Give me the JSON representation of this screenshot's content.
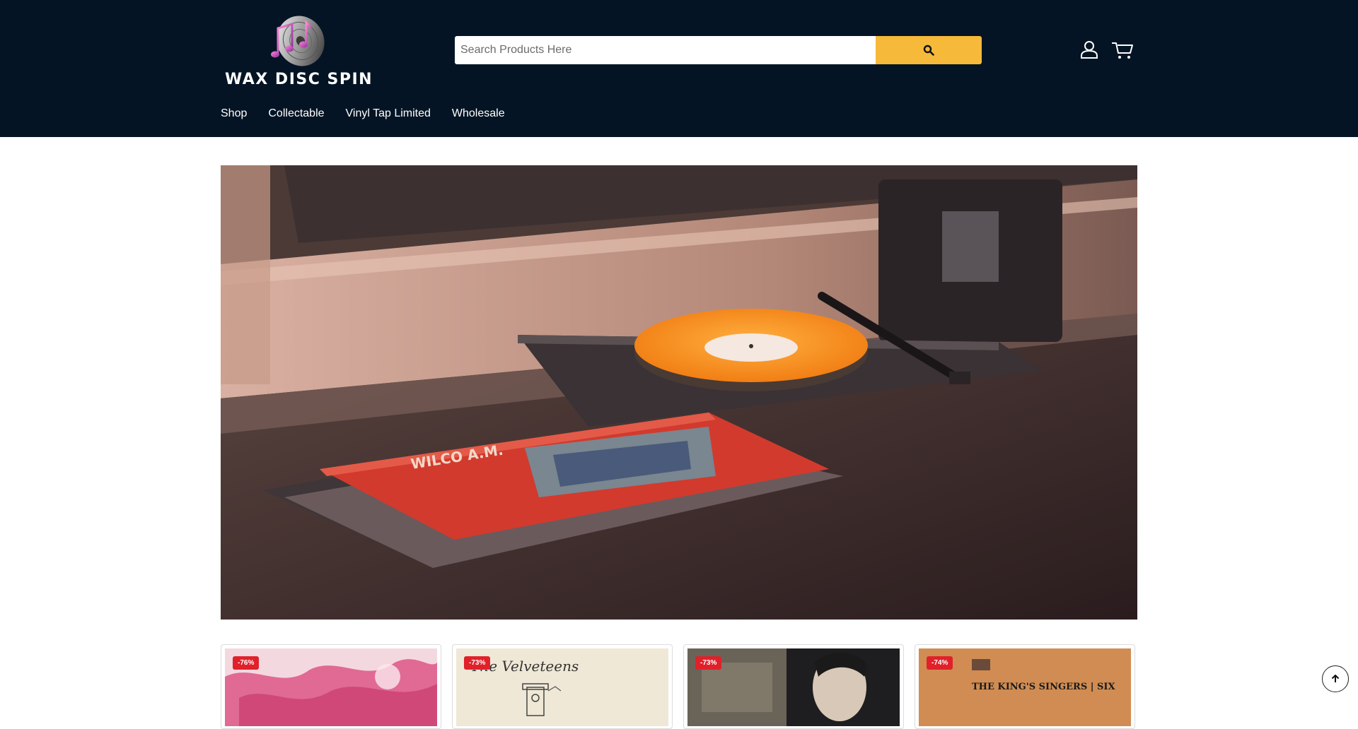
{
  "brand": {
    "name": "WAX DISC SPIN"
  },
  "search": {
    "placeholder": "Search Products Here"
  },
  "header_icons": {
    "account": "user-icon",
    "cart": "cart-icon",
    "search": "search-icon"
  },
  "nav": {
    "items": [
      {
        "label": "Shop"
      },
      {
        "label": "Collectable"
      },
      {
        "label": "Vinyl Tap Limited"
      },
      {
        "label": "Wholesale"
      }
    ]
  },
  "products": [
    {
      "discount": "-76%"
    },
    {
      "discount": "-73%",
      "cover_text": "The Velveteens"
    },
    {
      "discount": "-73%"
    },
    {
      "discount": "-74%",
      "cover_text": "THE KING'S SINGERS | SIX"
    }
  ],
  "hero": {
    "album_text": "WILCO   A.M."
  },
  "colors": {
    "header_bg": "#041424",
    "search_button": "#f6b93a",
    "badge": "#e0212a"
  }
}
